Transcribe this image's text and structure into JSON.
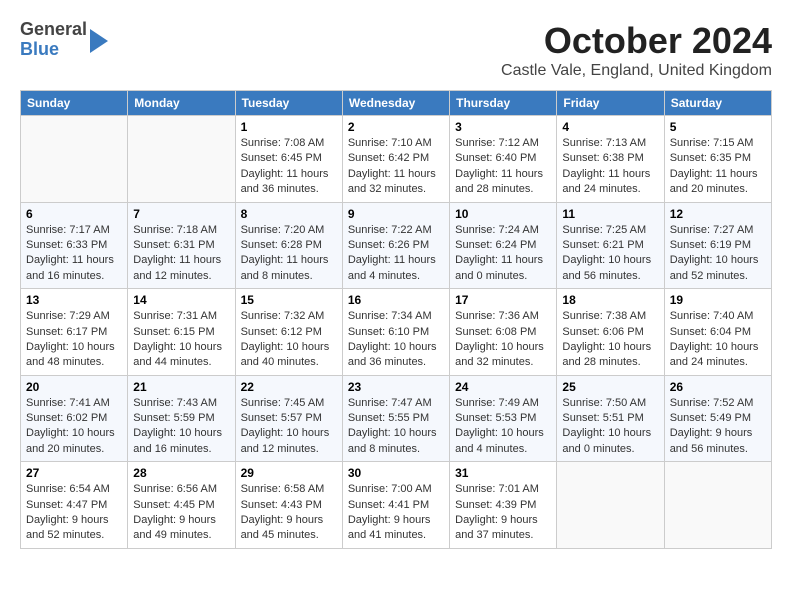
{
  "logo": {
    "general": "General",
    "blue": "Blue"
  },
  "title": "October 2024",
  "subtitle": "Castle Vale, England, United Kingdom",
  "days_of_week": [
    "Sunday",
    "Monday",
    "Tuesday",
    "Wednesday",
    "Thursday",
    "Friday",
    "Saturday"
  ],
  "weeks": [
    [
      {
        "day": "",
        "sunrise": "",
        "sunset": "",
        "daylight": ""
      },
      {
        "day": "",
        "sunrise": "",
        "sunset": "",
        "daylight": ""
      },
      {
        "day": "1",
        "sunrise": "Sunrise: 7:08 AM",
        "sunset": "Sunset: 6:45 PM",
        "daylight": "Daylight: 11 hours and 36 minutes."
      },
      {
        "day": "2",
        "sunrise": "Sunrise: 7:10 AM",
        "sunset": "Sunset: 6:42 PM",
        "daylight": "Daylight: 11 hours and 32 minutes."
      },
      {
        "day": "3",
        "sunrise": "Sunrise: 7:12 AM",
        "sunset": "Sunset: 6:40 PM",
        "daylight": "Daylight: 11 hours and 28 minutes."
      },
      {
        "day": "4",
        "sunrise": "Sunrise: 7:13 AM",
        "sunset": "Sunset: 6:38 PM",
        "daylight": "Daylight: 11 hours and 24 minutes."
      },
      {
        "day": "5",
        "sunrise": "Sunrise: 7:15 AM",
        "sunset": "Sunset: 6:35 PM",
        "daylight": "Daylight: 11 hours and 20 minutes."
      }
    ],
    [
      {
        "day": "6",
        "sunrise": "Sunrise: 7:17 AM",
        "sunset": "Sunset: 6:33 PM",
        "daylight": "Daylight: 11 hours and 16 minutes."
      },
      {
        "day": "7",
        "sunrise": "Sunrise: 7:18 AM",
        "sunset": "Sunset: 6:31 PM",
        "daylight": "Daylight: 11 hours and 12 minutes."
      },
      {
        "day": "8",
        "sunrise": "Sunrise: 7:20 AM",
        "sunset": "Sunset: 6:28 PM",
        "daylight": "Daylight: 11 hours and 8 minutes."
      },
      {
        "day": "9",
        "sunrise": "Sunrise: 7:22 AM",
        "sunset": "Sunset: 6:26 PM",
        "daylight": "Daylight: 11 hours and 4 minutes."
      },
      {
        "day": "10",
        "sunrise": "Sunrise: 7:24 AM",
        "sunset": "Sunset: 6:24 PM",
        "daylight": "Daylight: 11 hours and 0 minutes."
      },
      {
        "day": "11",
        "sunrise": "Sunrise: 7:25 AM",
        "sunset": "Sunset: 6:21 PM",
        "daylight": "Daylight: 10 hours and 56 minutes."
      },
      {
        "day": "12",
        "sunrise": "Sunrise: 7:27 AM",
        "sunset": "Sunset: 6:19 PM",
        "daylight": "Daylight: 10 hours and 52 minutes."
      }
    ],
    [
      {
        "day": "13",
        "sunrise": "Sunrise: 7:29 AM",
        "sunset": "Sunset: 6:17 PM",
        "daylight": "Daylight: 10 hours and 48 minutes."
      },
      {
        "day": "14",
        "sunrise": "Sunrise: 7:31 AM",
        "sunset": "Sunset: 6:15 PM",
        "daylight": "Daylight: 10 hours and 44 minutes."
      },
      {
        "day": "15",
        "sunrise": "Sunrise: 7:32 AM",
        "sunset": "Sunset: 6:12 PM",
        "daylight": "Daylight: 10 hours and 40 minutes."
      },
      {
        "day": "16",
        "sunrise": "Sunrise: 7:34 AM",
        "sunset": "Sunset: 6:10 PM",
        "daylight": "Daylight: 10 hours and 36 minutes."
      },
      {
        "day": "17",
        "sunrise": "Sunrise: 7:36 AM",
        "sunset": "Sunset: 6:08 PM",
        "daylight": "Daylight: 10 hours and 32 minutes."
      },
      {
        "day": "18",
        "sunrise": "Sunrise: 7:38 AM",
        "sunset": "Sunset: 6:06 PM",
        "daylight": "Daylight: 10 hours and 28 minutes."
      },
      {
        "day": "19",
        "sunrise": "Sunrise: 7:40 AM",
        "sunset": "Sunset: 6:04 PM",
        "daylight": "Daylight: 10 hours and 24 minutes."
      }
    ],
    [
      {
        "day": "20",
        "sunrise": "Sunrise: 7:41 AM",
        "sunset": "Sunset: 6:02 PM",
        "daylight": "Daylight: 10 hours and 20 minutes."
      },
      {
        "day": "21",
        "sunrise": "Sunrise: 7:43 AM",
        "sunset": "Sunset: 5:59 PM",
        "daylight": "Daylight: 10 hours and 16 minutes."
      },
      {
        "day": "22",
        "sunrise": "Sunrise: 7:45 AM",
        "sunset": "Sunset: 5:57 PM",
        "daylight": "Daylight: 10 hours and 12 minutes."
      },
      {
        "day": "23",
        "sunrise": "Sunrise: 7:47 AM",
        "sunset": "Sunset: 5:55 PM",
        "daylight": "Daylight: 10 hours and 8 minutes."
      },
      {
        "day": "24",
        "sunrise": "Sunrise: 7:49 AM",
        "sunset": "Sunset: 5:53 PM",
        "daylight": "Daylight: 10 hours and 4 minutes."
      },
      {
        "day": "25",
        "sunrise": "Sunrise: 7:50 AM",
        "sunset": "Sunset: 5:51 PM",
        "daylight": "Daylight: 10 hours and 0 minutes."
      },
      {
        "day": "26",
        "sunrise": "Sunrise: 7:52 AM",
        "sunset": "Sunset: 5:49 PM",
        "daylight": "Daylight: 9 hours and 56 minutes."
      }
    ],
    [
      {
        "day": "27",
        "sunrise": "Sunrise: 6:54 AM",
        "sunset": "Sunset: 4:47 PM",
        "daylight": "Daylight: 9 hours and 52 minutes."
      },
      {
        "day": "28",
        "sunrise": "Sunrise: 6:56 AM",
        "sunset": "Sunset: 4:45 PM",
        "daylight": "Daylight: 9 hours and 49 minutes."
      },
      {
        "day": "29",
        "sunrise": "Sunrise: 6:58 AM",
        "sunset": "Sunset: 4:43 PM",
        "daylight": "Daylight: 9 hours and 45 minutes."
      },
      {
        "day": "30",
        "sunrise": "Sunrise: 7:00 AM",
        "sunset": "Sunset: 4:41 PM",
        "daylight": "Daylight: 9 hours and 41 minutes."
      },
      {
        "day": "31",
        "sunrise": "Sunrise: 7:01 AM",
        "sunset": "Sunset: 4:39 PM",
        "daylight": "Daylight: 9 hours and 37 minutes."
      },
      {
        "day": "",
        "sunrise": "",
        "sunset": "",
        "daylight": ""
      },
      {
        "day": "",
        "sunrise": "",
        "sunset": "",
        "daylight": ""
      }
    ]
  ]
}
